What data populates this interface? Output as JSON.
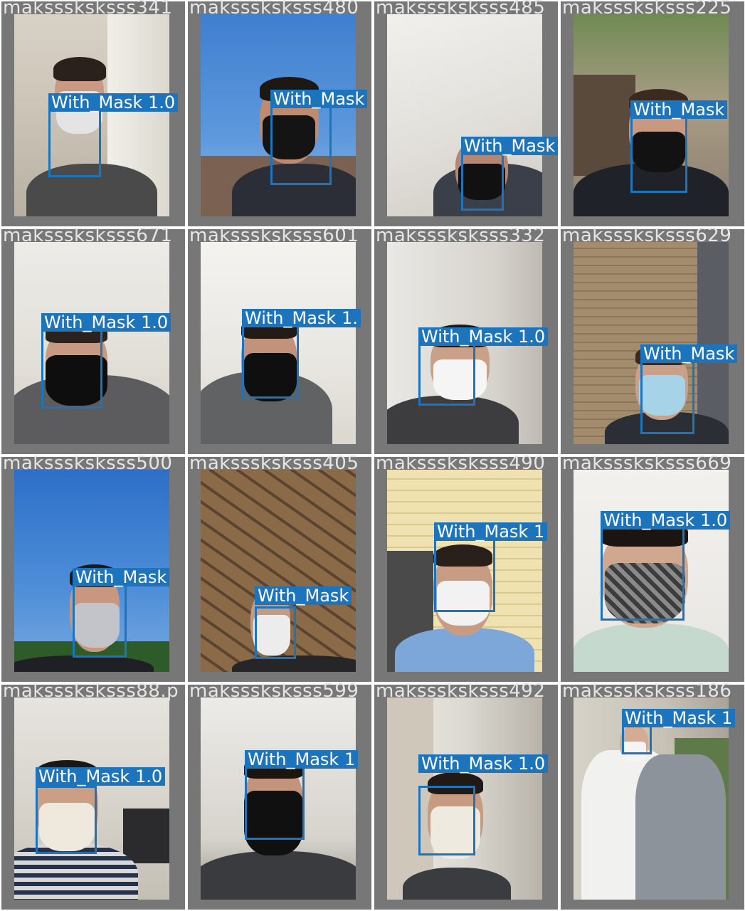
{
  "colors": {
    "box": "#1c75bc",
    "label_text": "#ffffff",
    "filename_text": "#e6e6e6",
    "tile_border": "#777777"
  },
  "tiles": [
    {
      "filename": "maksssksksss341",
      "label": "With_Mask 1.0"
    },
    {
      "filename": "maksssksksss480",
      "label": "With_Mask"
    },
    {
      "filename": "maksssksksss485",
      "label": "With_Mask"
    },
    {
      "filename": "maksssksksss225",
      "label": "With_Mask"
    },
    {
      "filename": "maksssksksss671",
      "label": "With_Mask 1.0"
    },
    {
      "filename": "maksssksksss601",
      "label": "With_Mask 1."
    },
    {
      "filename": "maksssksksss332",
      "label": "With_Mask 1.0"
    },
    {
      "filename": "maksssksksss629",
      "label": "With_Mask"
    },
    {
      "filename": "maksssksksss500",
      "label": "With_Mask"
    },
    {
      "filename": "maksssksksss405",
      "label": "With_Mask"
    },
    {
      "filename": "maksssksksss490",
      "label": "With_Mask 1"
    },
    {
      "filename": "maksssksksss669",
      "label": "With_Mask 1.0"
    },
    {
      "filename": "maksssksksss88.p",
      "label": "With_Mask 1.0"
    },
    {
      "filename": "maksssksksss599",
      "label": "With_Mask 1"
    },
    {
      "filename": "maksssksksss492",
      "label": "With_Mask 1.0"
    },
    {
      "filename": "maksssksksss186",
      "label": "With_Mask 1"
    }
  ]
}
